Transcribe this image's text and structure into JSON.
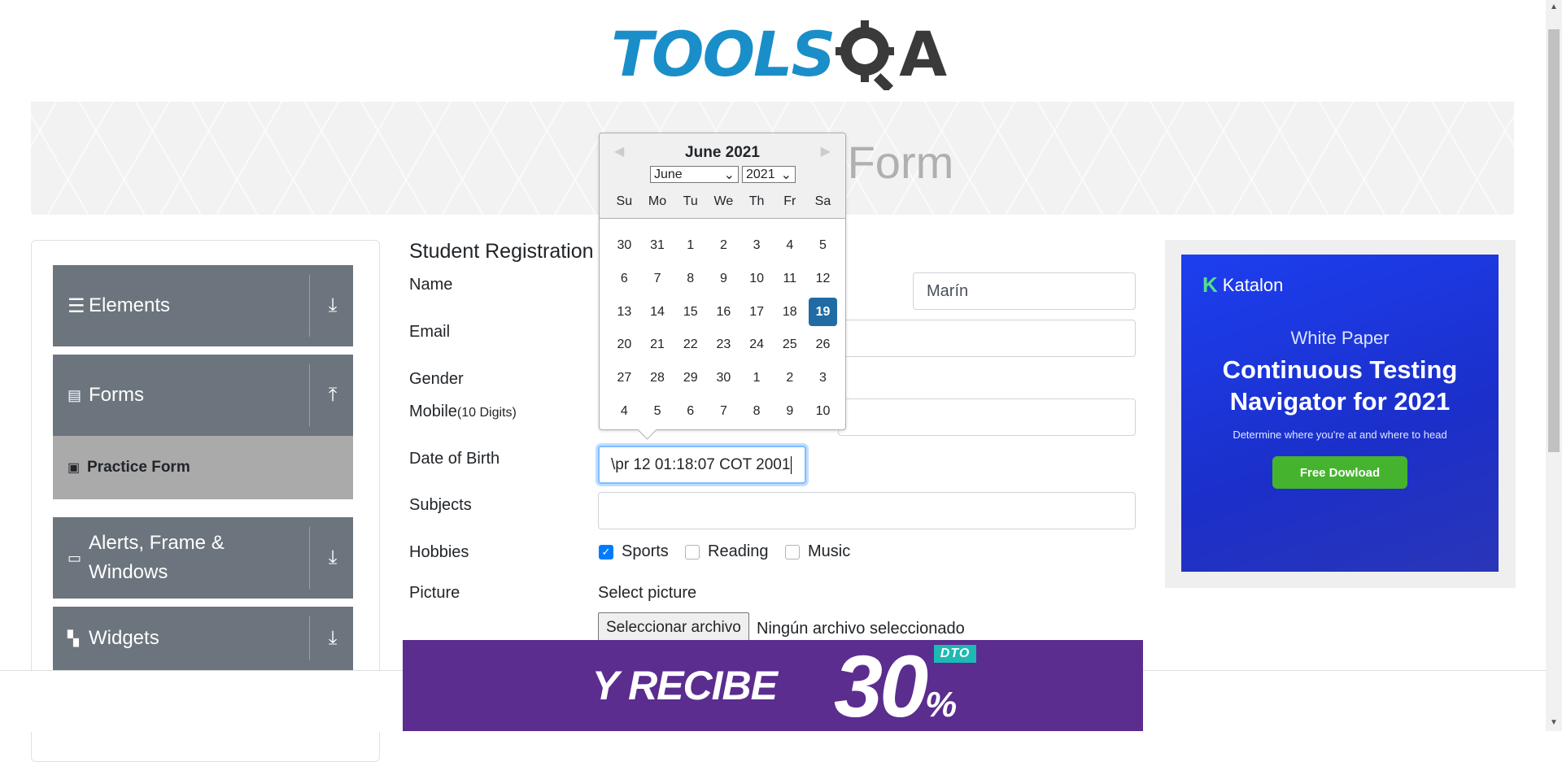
{
  "logo": {
    "tools": "TOOLS",
    "qa": "QA"
  },
  "banner": {
    "title": "Practice Form"
  },
  "sidebar": {
    "groups": [
      {
        "label": "Elements",
        "icon": "hamburger-icon",
        "arrow": "download-icon"
      },
      {
        "label": "Forms",
        "icon": "document-icon",
        "arrow": "upload-icon"
      },
      {
        "label": "Alerts, Frame & Windows",
        "icon": "window-icon",
        "arrow": "download-icon"
      },
      {
        "label": "Widgets",
        "icon": "widgets-icon",
        "arrow": "download-icon"
      }
    ],
    "active_item": {
      "label": "Practice Form",
      "icon": "form-icon"
    }
  },
  "form": {
    "title": "Student Registration Form",
    "name_label": "Name",
    "last_name_value": "Marín",
    "email_label": "Email",
    "gender_label": "Gender",
    "mobile_label": "Mobile",
    "mobile_hint": "(10 Digits)",
    "dob_label": "Date of Birth",
    "dob_value": "\\pr 12 01:18:07 COT 2001",
    "subjects_label": "Subjects",
    "hobbies_label": "Hobbies",
    "hobbies": [
      {
        "label": "Sports",
        "checked": true
      },
      {
        "label": "Reading",
        "checked": false
      },
      {
        "label": "Music",
        "checked": false
      }
    ],
    "picture_label": "Picture",
    "select_picture": "Select picture",
    "file_button": "Seleccionar archivo",
    "file_status": "Ningún archivo seleccionado"
  },
  "datepicker": {
    "header": "June 2021",
    "month_select": "June",
    "year_select": "2021",
    "weekdays": [
      "Su",
      "Mo",
      "Tu",
      "We",
      "Th",
      "Fr",
      "Sa"
    ],
    "days": [
      "30",
      "31",
      "1",
      "2",
      "3",
      "4",
      "5",
      "6",
      "7",
      "8",
      "9",
      "10",
      "11",
      "12",
      "13",
      "14",
      "15",
      "16",
      "17",
      "18",
      "19",
      "20",
      "21",
      "22",
      "23",
      "24",
      "25",
      "26",
      "27",
      "28",
      "29",
      "30",
      "1",
      "2",
      "3",
      "4",
      "5",
      "6",
      "7",
      "8",
      "9",
      "10"
    ],
    "selected_day": "19"
  },
  "ad": {
    "brand": "Katalon",
    "line1": "White Paper",
    "line2": "Continuous Testing Navigator for 2021",
    "line3": "Determine where you're at and where to head",
    "button": "Free Dowload"
  },
  "bottom_ad": {
    "text1": "Y RECIBE",
    "text2": "30",
    "badge": "DTO",
    "percent": "%"
  },
  "colors": {
    "brand_blue": "#1a8ec9",
    "sidebar_gray": "#6c757d",
    "selected_day": "#216ba5",
    "checkbox_blue": "#007bff",
    "ad_green": "#46b32f"
  }
}
